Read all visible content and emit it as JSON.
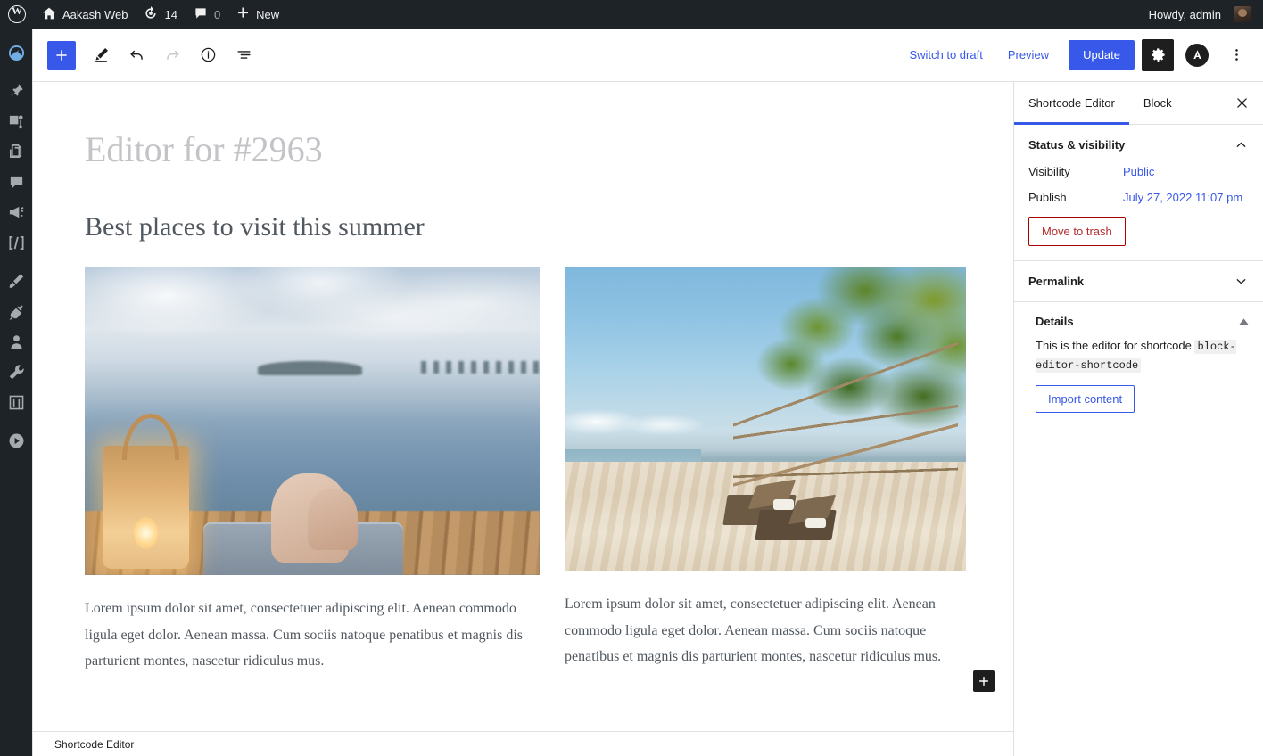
{
  "adminbar": {
    "logo_icon": "wordpress-logo-icon",
    "site_name": "Aakash Web",
    "home_icon": "home-icon",
    "updates_icon": "updates-icon",
    "updates_count": "14",
    "comments_icon": "comment-bubble-icon",
    "comments_count": "0",
    "new_icon": "plus-icon",
    "new_label": "New",
    "howdy": "Howdy, admin",
    "avatar_icon": "user-avatar"
  },
  "adminmenu": {
    "items": [
      {
        "icon": "dashboard-gauge-icon",
        "current": true
      },
      {
        "icon": "pin-posts-icon",
        "current": false
      },
      {
        "icon": "media-images-icon",
        "current": false
      },
      {
        "icon": "pages-icon",
        "current": false
      },
      {
        "icon": "comments-bubble-icon",
        "current": false
      },
      {
        "icon": "megaphone-icon",
        "current": false
      },
      {
        "icon": "shortcode-brackets-icon",
        "current": false
      },
      {
        "icon": "appearance-brush-icon",
        "current": false
      },
      {
        "icon": "plugins-plug-icon",
        "current": false
      },
      {
        "icon": "users-person-icon",
        "current": false
      },
      {
        "icon": "tools-wrench-icon",
        "current": false
      },
      {
        "icon": "settings-sliders-icon",
        "current": false
      },
      {
        "icon": "play-circle-icon",
        "current": false
      }
    ]
  },
  "header": {
    "add_block_icon": "plus-icon",
    "tools_icon": "pencil-edit-icon",
    "undo_icon": "undo-arrow-icon",
    "redo_icon": "redo-arrow-icon",
    "info_icon": "info-circle-icon",
    "list_view_icon": "list-view-icon",
    "switch_to_draft": "Switch to draft",
    "preview": "Preview",
    "update": "Update",
    "settings_icon": "gear-icon",
    "brand_icon": "brand-logo-icon",
    "brand_letter": "A",
    "options_icon": "three-dots-vertical-icon",
    "accent_color": "#3858e9"
  },
  "canvas": {
    "title_placeholder": "Editor for #2963",
    "heading": "Best places to visit this summer",
    "columns": [
      {
        "image_alt": "beach-deck-lantern-photo",
        "paragraph": "Lorem ipsum dolor sit amet, consectetuer adipiscing elit. Aenean commodo ligula eget dolor. Aenean massa. Cum sociis natoque penatibus et magnis dis parturient montes, nascetur ridiculus mus."
      },
      {
        "image_alt": "palm-beach-loungers-photo",
        "paragraph": "Lorem ipsum dolor sit amet, consectetuer adipiscing elit. Aenean commodo ligula eget dolor. Aenean massa. Cum sociis natoque penatibus et magnis dis parturient montes, nascetur ridiculus mus."
      }
    ],
    "appender_icon": "plus-icon",
    "breadcrumb": "Shortcode Editor"
  },
  "scrollbar": {
    "up_icon": "caret-up-icon",
    "down_icon": "caret-down-icon"
  },
  "sidebar": {
    "tab_document": "Shortcode Editor",
    "tab_block": "Block",
    "close_icon": "close-x-icon",
    "status": {
      "title": "Status & visibility",
      "toggle_icon": "chevron-up-icon",
      "visibility_label": "Visibility",
      "visibility_value": "Public",
      "publish_label": "Publish",
      "publish_value": "July 27, 2022 11:07 pm",
      "trash_label": "Move to trash",
      "trash_color": "#b32d2e"
    },
    "permalink": {
      "title": "Permalink",
      "toggle_icon": "chevron-down-icon"
    },
    "details": {
      "title": "Details",
      "toggle_icon": "triangle-up-icon",
      "text_before": "This is the editor for shortcode",
      "code": "block-editor-shortcode",
      "import_label": "Import content"
    }
  }
}
